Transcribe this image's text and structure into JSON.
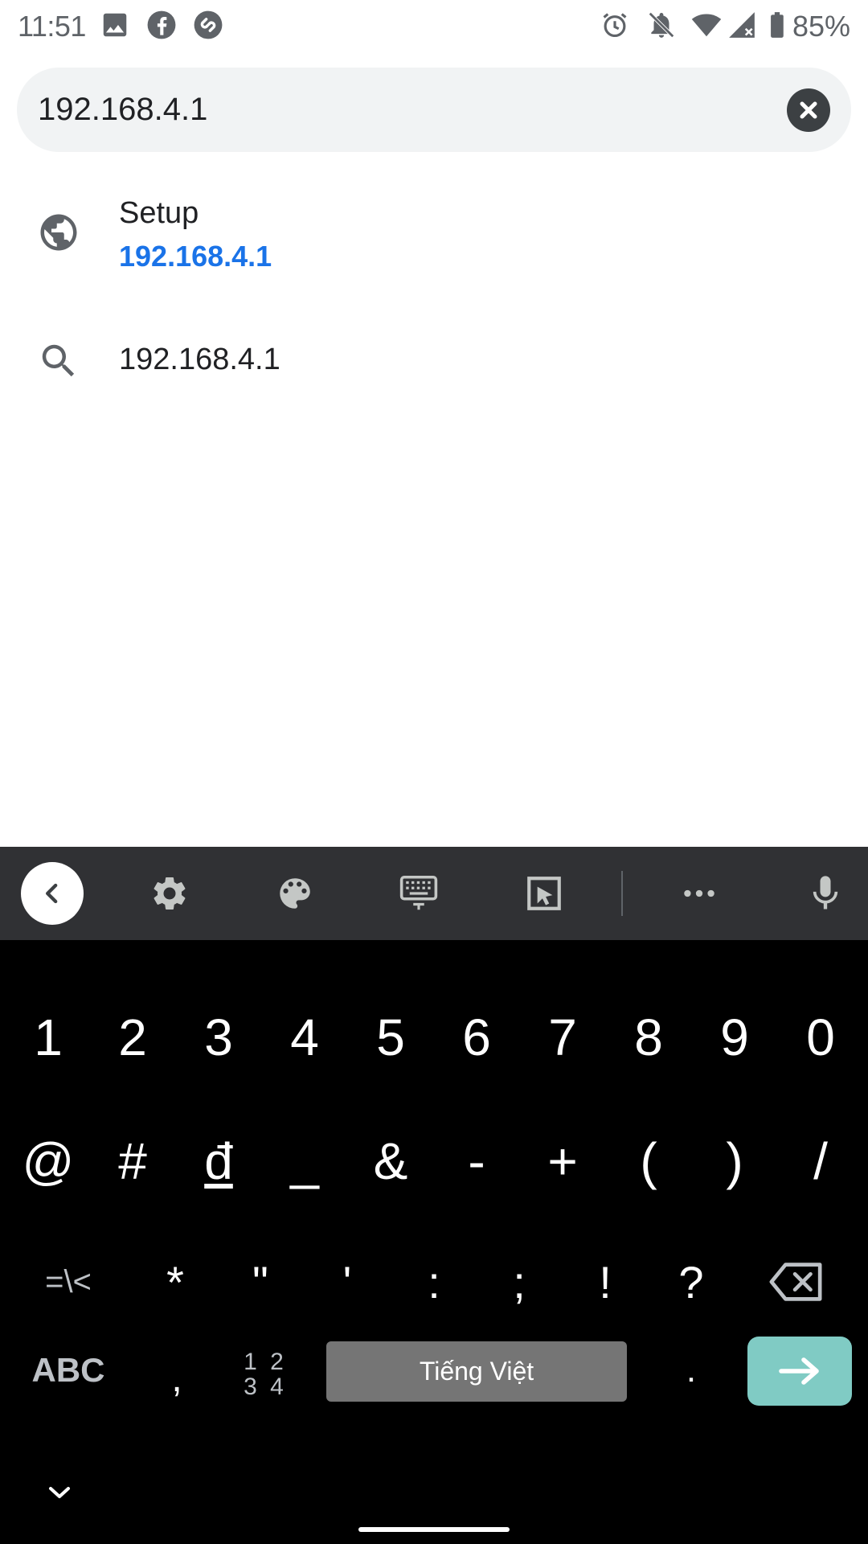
{
  "status_bar": {
    "time": "11:51",
    "battery": "85%",
    "icons": [
      "image-icon",
      "facebook-icon",
      "shazam-icon",
      "alarm-icon",
      "notifications-off-icon",
      "wifi-icon",
      "signal-icon",
      "battery-icon"
    ]
  },
  "omnibox": {
    "value": "192.168.4.1",
    "clear_icon": "close-icon"
  },
  "suggestions": [
    {
      "icon": "globe-icon",
      "title": "Setup",
      "url": "192.168.4.1"
    },
    {
      "icon": "search-icon",
      "title": "192.168.4.1"
    }
  ],
  "keyboard": {
    "toolbar_icons": [
      "chevron-left-icon",
      "gear-icon",
      "palette-icon",
      "keyboard-icon",
      "one-handed-icon",
      "more-icon",
      "mic-icon"
    ],
    "row1": [
      "1",
      "2",
      "3",
      "4",
      "5",
      "6",
      "7",
      "8",
      "9",
      "0"
    ],
    "row2": [
      "@",
      "#",
      "đ",
      "_",
      "&",
      "-",
      "+",
      "(",
      ")",
      "/"
    ],
    "row3": [
      "=\\<",
      "*",
      "\"",
      "'",
      ":",
      ";",
      "!",
      "?"
    ],
    "abc_label": "ABC",
    "comma": ",",
    "numpad_label_top": "1 2",
    "numpad_label_bottom": "3 4",
    "space_label": "Tiếng Việt",
    "period": ".",
    "colors": {
      "toolbar_bg": "#303134",
      "keys_bg": "#000000",
      "enter_bg": "#80cbc4",
      "space_bg": "#757575"
    }
  }
}
